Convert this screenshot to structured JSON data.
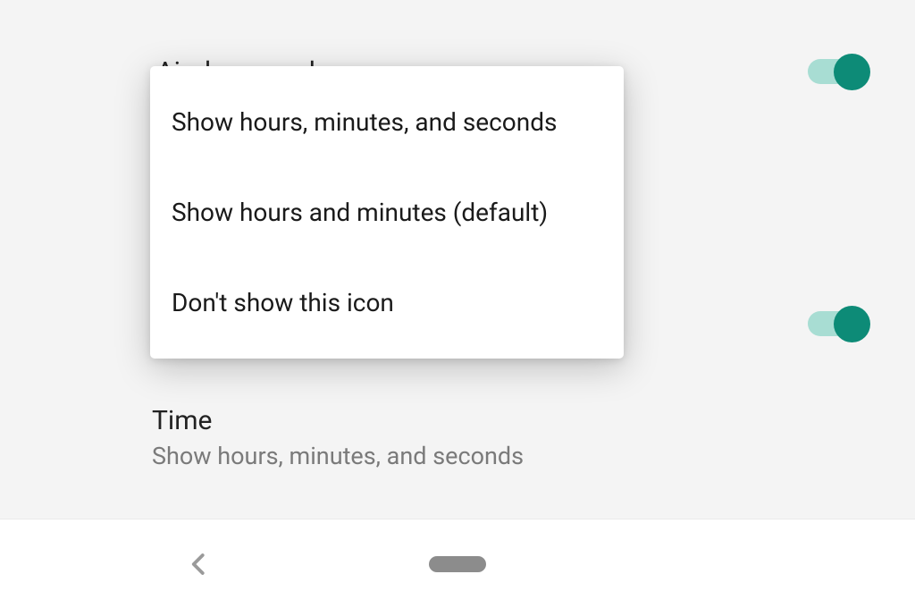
{
  "settings": {
    "airplane_mode_label": "Airplane mode",
    "time_label": "Time",
    "time_summary": "Show hours, minutes, and seconds"
  },
  "popup": {
    "options": [
      "Show hours, minutes, and seconds",
      "Show hours and minutes (default)",
      "Don't show this icon"
    ]
  },
  "colors": {
    "toggle_on": "#0d8b77",
    "toggle_track_on": "#a8ddd3"
  }
}
